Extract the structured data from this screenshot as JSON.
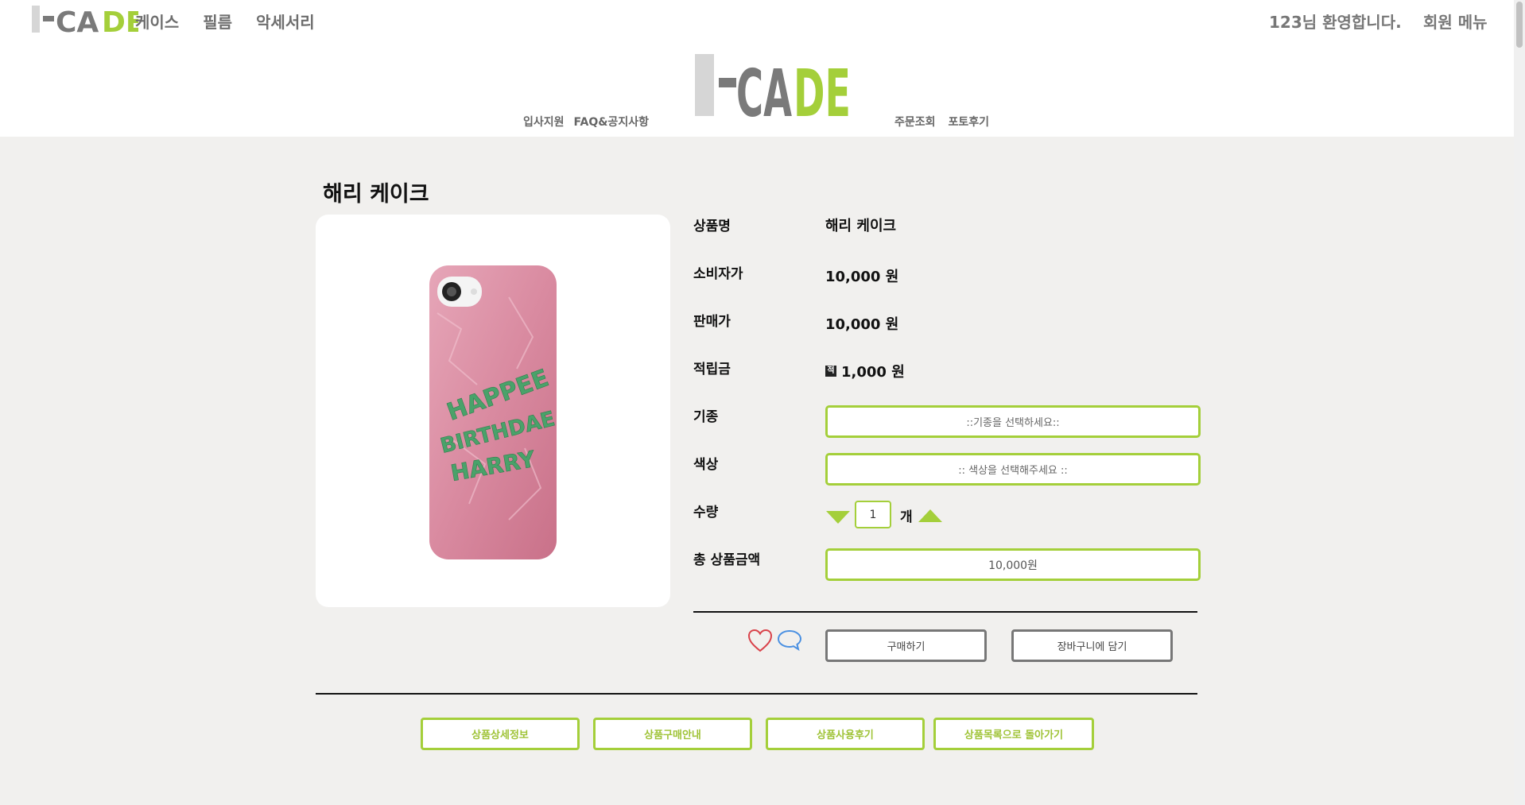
{
  "brand": {
    "logo_text": "I-CADE",
    "logo_part1": "I-",
    "logo_part2": "CA",
    "logo_part3": "DE"
  },
  "topnav": {
    "items": [
      "케이스",
      "필름",
      "악세서리"
    ]
  },
  "user": {
    "welcome": "123님 환영합니다.",
    "member_menu": "회원 메뉴"
  },
  "subnav": {
    "left": [
      "입사지원",
      "FAQ&공지사항"
    ],
    "right": [
      "주문조회",
      "포토후기"
    ]
  },
  "product": {
    "title": "해리 케이크",
    "image_text": [
      "HAPPEE",
      "BIRTHDAE",
      "HARRY"
    ],
    "labels": {
      "name": "상품명",
      "consumer_price": "소비자가",
      "sale_price": "판매가",
      "points": "적립금",
      "model": "기종",
      "color": "색상",
      "quantity": "수량",
      "total": "총 상품금액"
    },
    "name": "해리 케이크",
    "consumer_price": "10,000 원",
    "sale_price": "10,000 원",
    "points_badge": "적",
    "points": "1,000 원",
    "model_placeholder": "::기종을 선택하세요::",
    "color_placeholder": ":: 색상을 선택해주세요 ::",
    "quantity": "1",
    "quantity_unit": "개",
    "total": "10,000원"
  },
  "actions": {
    "buy": "구매하기",
    "cart": "장바구니에 담기"
  },
  "tabs": [
    "상품상세정보",
    "상품구매안내",
    "상품사용후기",
    "상품목록으로 돌아가기"
  ],
  "colors": {
    "accent": "#a4cf3a",
    "logo_grey": "#7a7a7a",
    "logo_light": "#d6d6d6",
    "heart": "#d9424a",
    "chat": "#4a90e2"
  }
}
